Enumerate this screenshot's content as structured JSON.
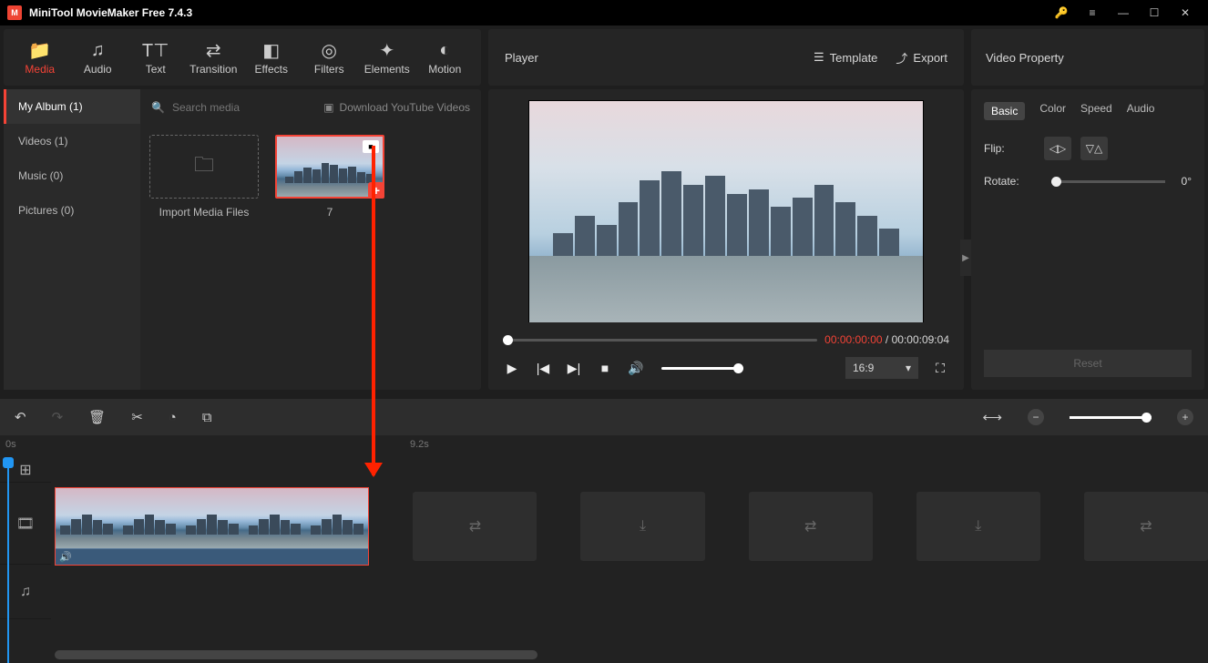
{
  "app": {
    "title": "MiniTool MovieMaker Free 7.4.3"
  },
  "tabs": {
    "media": "Media",
    "audio": "Audio",
    "text": "Text",
    "transition": "Transition",
    "effects": "Effects",
    "filters": "Filters",
    "elements": "Elements",
    "motion": "Motion"
  },
  "player": {
    "label": "Player",
    "template": "Template",
    "export": "Export",
    "current": "00:00:00:00",
    "sep": " / ",
    "total": "00:00:09:04",
    "aspect": "16:9"
  },
  "property": {
    "title": "Video Property",
    "tabs": {
      "basic": "Basic",
      "color": "Color",
      "speed": "Speed",
      "audio": "Audio"
    },
    "flip": "Flip:",
    "rotate": "Rotate:",
    "rotate_val": "0°",
    "reset": "Reset"
  },
  "media": {
    "album": "My Album (1)",
    "videos": "Videos (1)",
    "music": "Music (0)",
    "pictures": "Pictures (0)",
    "search_ph": "Search media",
    "yt": "Download YouTube Videos",
    "import": "Import Media Files",
    "clip_label": "7"
  },
  "timeline": {
    "mark0": "0s",
    "mark1": "9.2s"
  }
}
